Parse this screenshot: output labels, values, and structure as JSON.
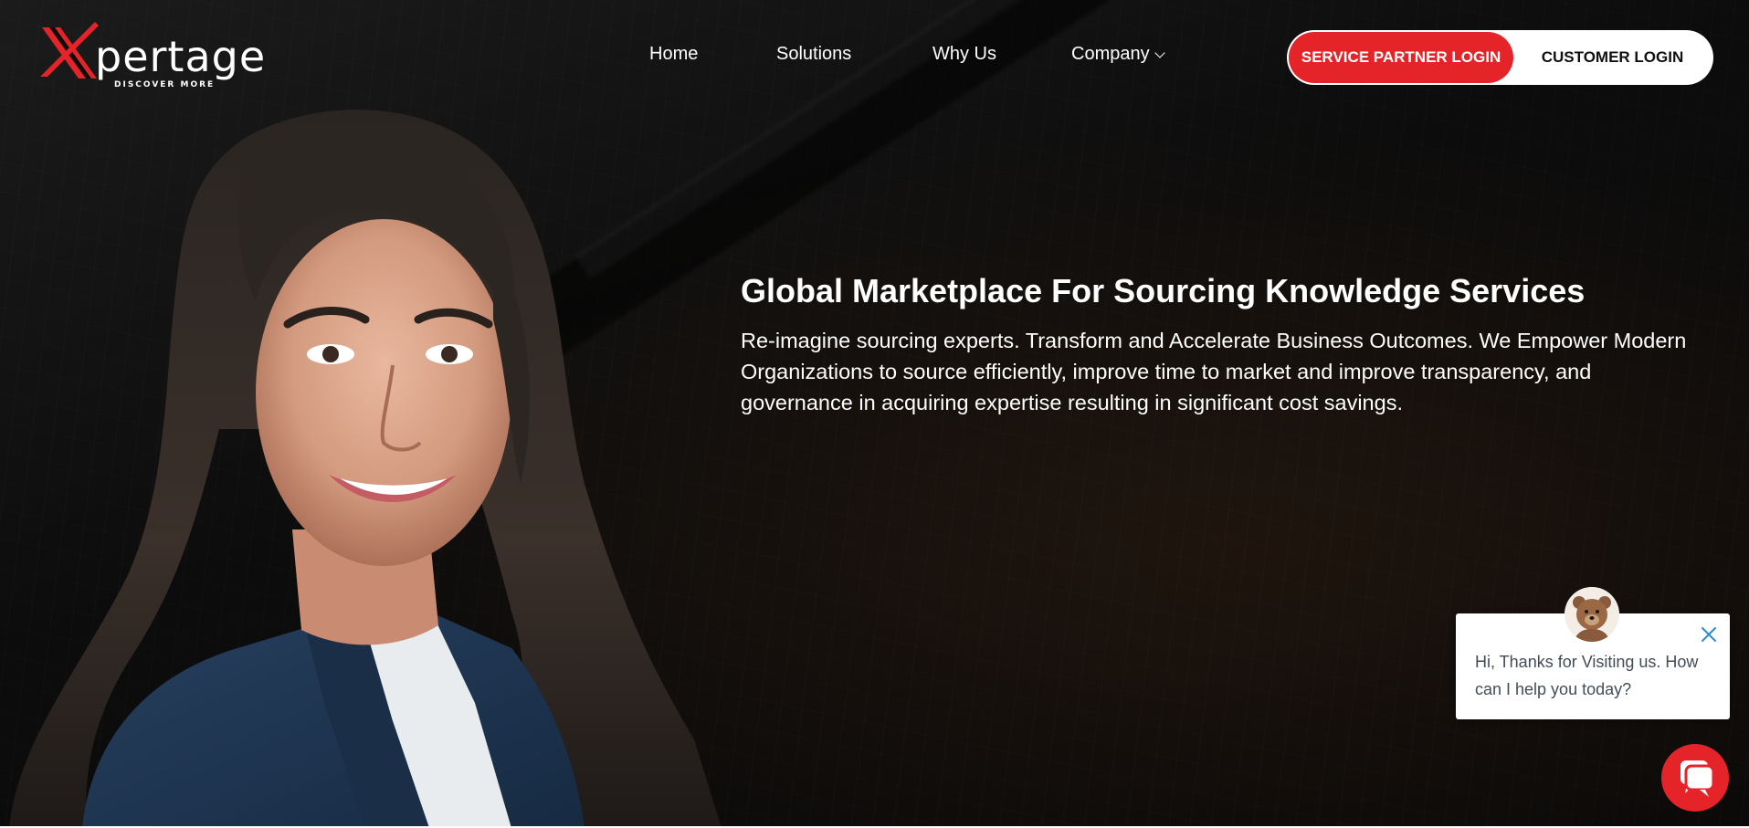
{
  "brand": {
    "logo_text": "pertage",
    "tagline": "DISCOVER MORE"
  },
  "nav": {
    "items": [
      {
        "label": "Home"
      },
      {
        "label": "Solutions"
      },
      {
        "label": "Why Us"
      },
      {
        "label": "Company"
      }
    ],
    "company_caret_icon": "chevron-down-icon"
  },
  "auth": {
    "service_partner_login": "SERVICE PARTNER LOGIN",
    "customer_login": "CUSTOMER LOGIN"
  },
  "hero": {
    "headline": "Global Marketplace For Sourcing Knowledge Services",
    "subtext": "Re-imagine sourcing experts. Transform and Accelerate Business Outcomes. We Empower Modern Organizations to source efficiently, improve time to market and improve transparency, and governance in acquiring expertise resulting in significant cost savings."
  },
  "chat": {
    "message": "Hi, Thanks for Visiting us. How can I help you today?",
    "close_icon": "close-icon",
    "launcher_icon": "chat-icon"
  },
  "colors": {
    "accent": "#e52429",
    "background": "#0c0c0c",
    "text": "#ffffff",
    "chat_text": "#444c56",
    "jacket": "#1f3550"
  }
}
